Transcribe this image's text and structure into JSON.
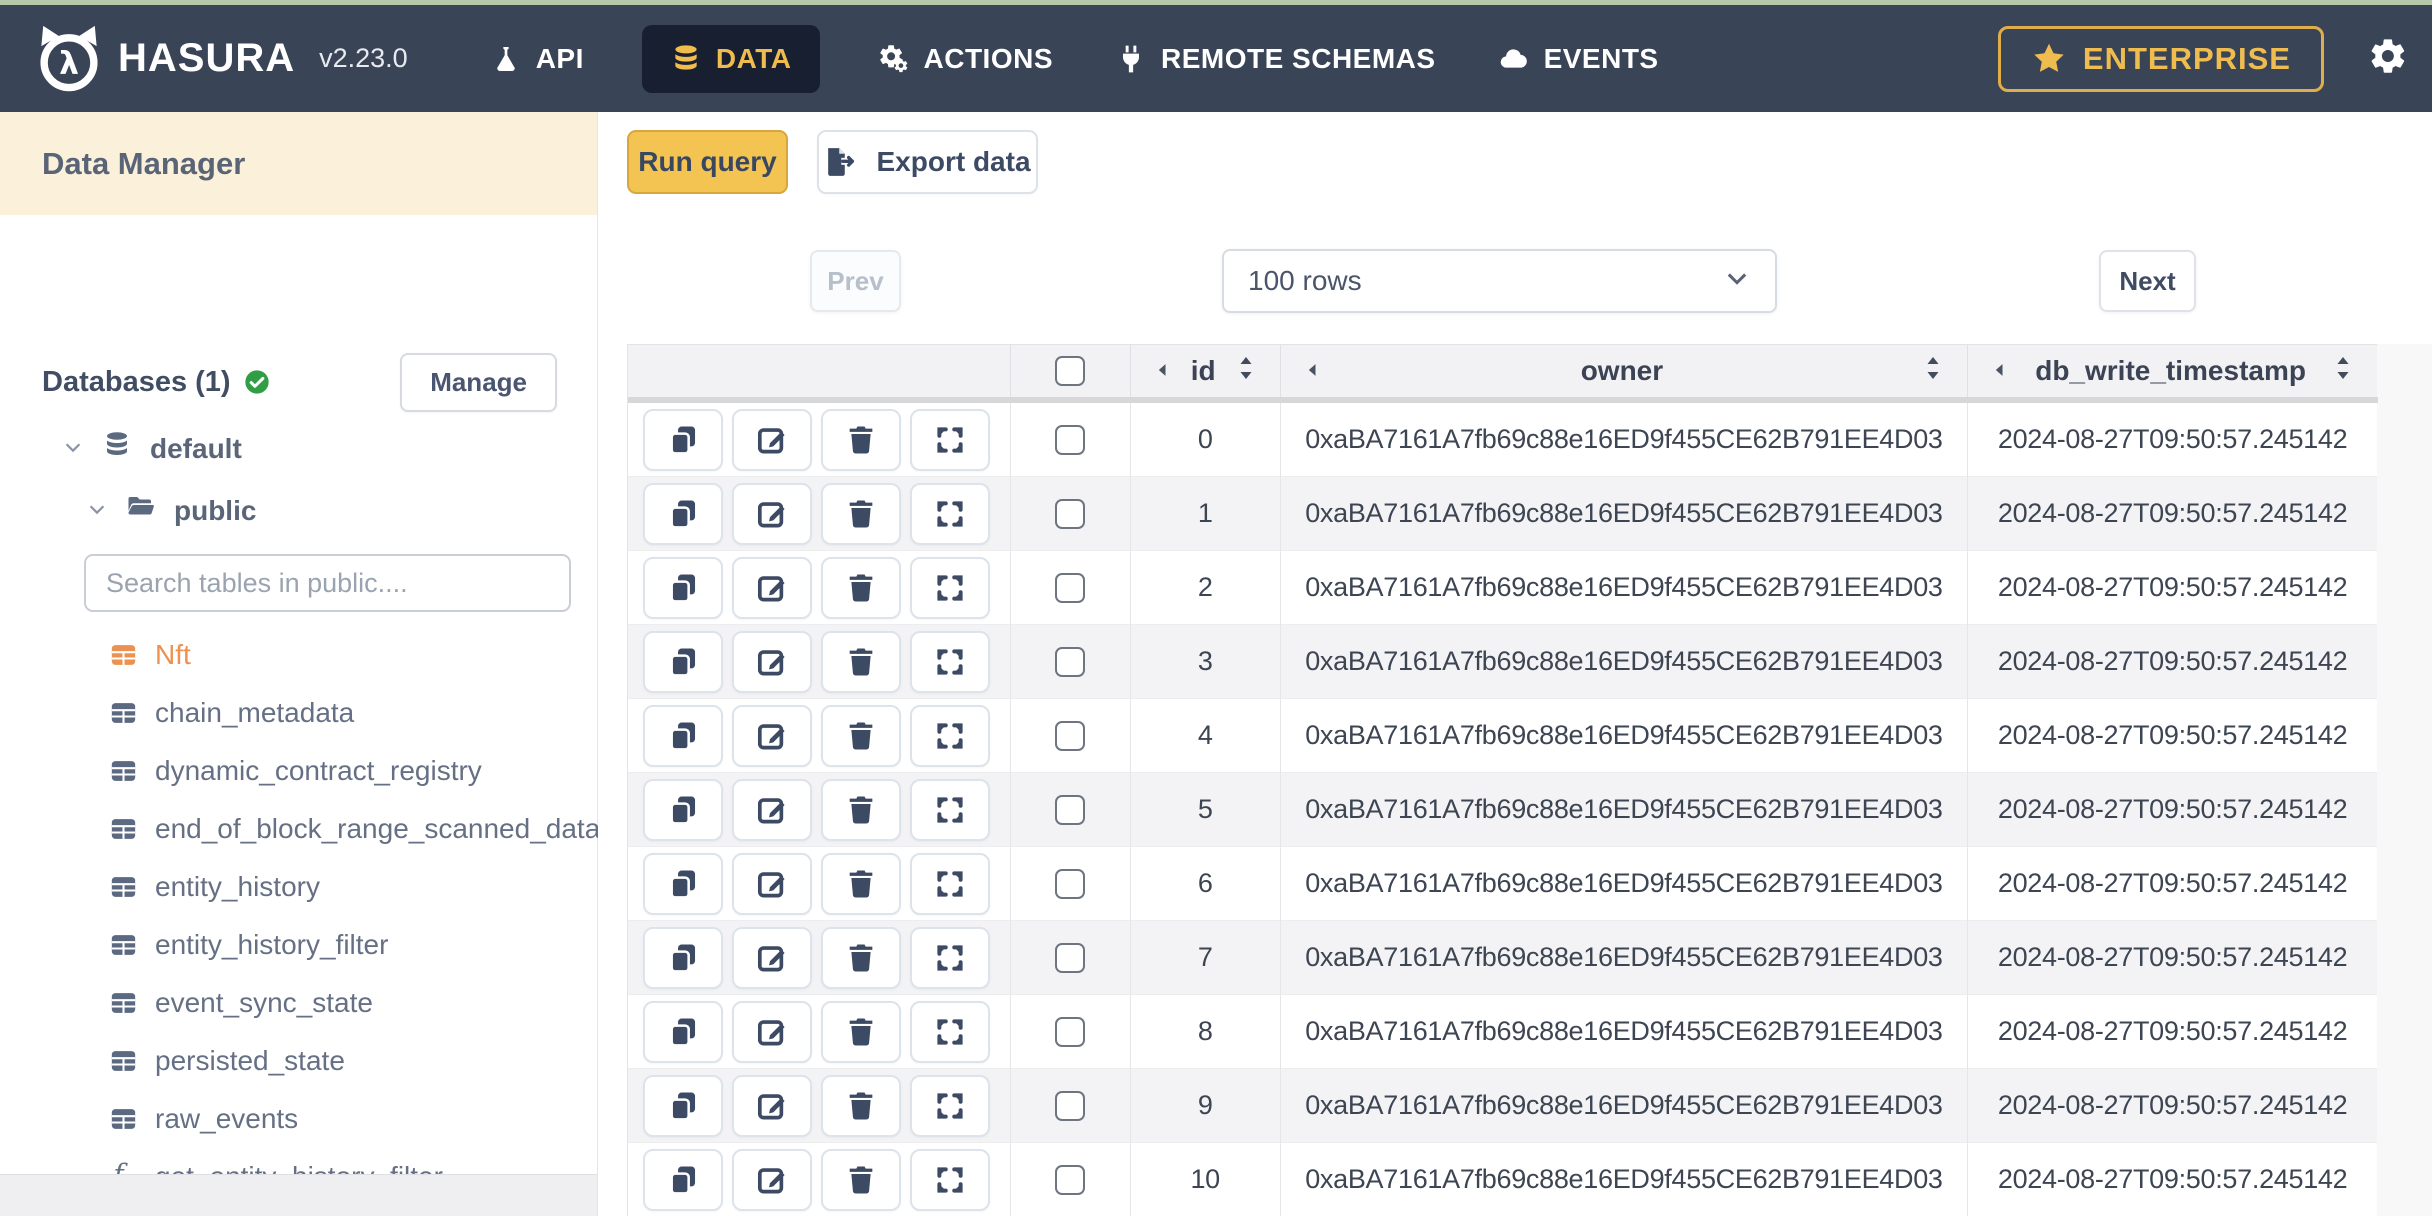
{
  "nav": {
    "brand": "HASURA",
    "version": "v2.23.0",
    "items": [
      {
        "label": "API",
        "icon": "flask-icon"
      },
      {
        "label": "DATA",
        "icon": "database-icon",
        "active": true
      },
      {
        "label": "ACTIONS",
        "icon": "gears-icon"
      },
      {
        "label": "REMOTE SCHEMAS",
        "icon": "plug-icon"
      },
      {
        "label": "EVENTS",
        "icon": "cloud-icon"
      }
    ],
    "enterprise_label": "ENTERPRISE"
  },
  "colors": {
    "nav_bg": "#3a4457",
    "active_tab_bg": "#171f30",
    "accent_gold": "#f0bc4c",
    "active_table_orange": "#ec914f",
    "sidebar_header_bg": "#fbf0d9",
    "run_query_bg": "#f4c452"
  },
  "sidebar": {
    "header": "Data Manager",
    "databases_label": "Databases (1)",
    "manage_label": "Manage",
    "tree": {
      "database": "default",
      "schema": "public"
    },
    "search_placeholder": "Search tables in public....",
    "tables": [
      {
        "name": "Nft",
        "type": "table",
        "active": true
      },
      {
        "name": "chain_metadata",
        "type": "table"
      },
      {
        "name": "dynamic_contract_registry",
        "type": "table"
      },
      {
        "name": "end_of_block_range_scanned_data",
        "type": "table"
      },
      {
        "name": "entity_history",
        "type": "table"
      },
      {
        "name": "entity_history_filter",
        "type": "table"
      },
      {
        "name": "event_sync_state",
        "type": "table"
      },
      {
        "name": "persisted_state",
        "type": "table"
      },
      {
        "name": "raw_events",
        "type": "table"
      },
      {
        "name": "get_entity_history_filter",
        "type": "function"
      }
    ]
  },
  "toolbar": {
    "run_query_label": "Run query",
    "export_data_label": "Export data"
  },
  "pagination": {
    "prev_label": "Prev",
    "rows_value": "100 rows",
    "next_label": "Next"
  },
  "table": {
    "columns": [
      "id",
      "owner",
      "db_write_timestamp"
    ],
    "rows": [
      {
        "id": "0",
        "owner": "0xaBA7161A7fb69c88e16ED9f455CE62B791EE4D03",
        "db_write_timestamp": "2024-08-27T09:50:57.245142"
      },
      {
        "id": "1",
        "owner": "0xaBA7161A7fb69c88e16ED9f455CE62B791EE4D03",
        "db_write_timestamp": "2024-08-27T09:50:57.245142"
      },
      {
        "id": "2",
        "owner": "0xaBA7161A7fb69c88e16ED9f455CE62B791EE4D03",
        "db_write_timestamp": "2024-08-27T09:50:57.245142"
      },
      {
        "id": "3",
        "owner": "0xaBA7161A7fb69c88e16ED9f455CE62B791EE4D03",
        "db_write_timestamp": "2024-08-27T09:50:57.245142"
      },
      {
        "id": "4",
        "owner": "0xaBA7161A7fb69c88e16ED9f455CE62B791EE4D03",
        "db_write_timestamp": "2024-08-27T09:50:57.245142"
      },
      {
        "id": "5",
        "owner": "0xaBA7161A7fb69c88e16ED9f455CE62B791EE4D03",
        "db_write_timestamp": "2024-08-27T09:50:57.245142"
      },
      {
        "id": "6",
        "owner": "0xaBA7161A7fb69c88e16ED9f455CE62B791EE4D03",
        "db_write_timestamp": "2024-08-27T09:50:57.245142"
      },
      {
        "id": "7",
        "owner": "0xaBA7161A7fb69c88e16ED9f455CE62B791EE4D03",
        "db_write_timestamp": "2024-08-27T09:50:57.245142"
      },
      {
        "id": "8",
        "owner": "0xaBA7161A7fb69c88e16ED9f455CE62B791EE4D03",
        "db_write_timestamp": "2024-08-27T09:50:57.245142"
      },
      {
        "id": "9",
        "owner": "0xaBA7161A7fb69c88e16ED9f455CE62B791EE4D03",
        "db_write_timestamp": "2024-08-27T09:50:57.245142"
      },
      {
        "id": "10",
        "owner": "0xaBA7161A7fb69c88e16ED9f455CE62B791EE4D03",
        "db_write_timestamp": "2024-08-27T09:50:57.245142"
      }
    ]
  }
}
